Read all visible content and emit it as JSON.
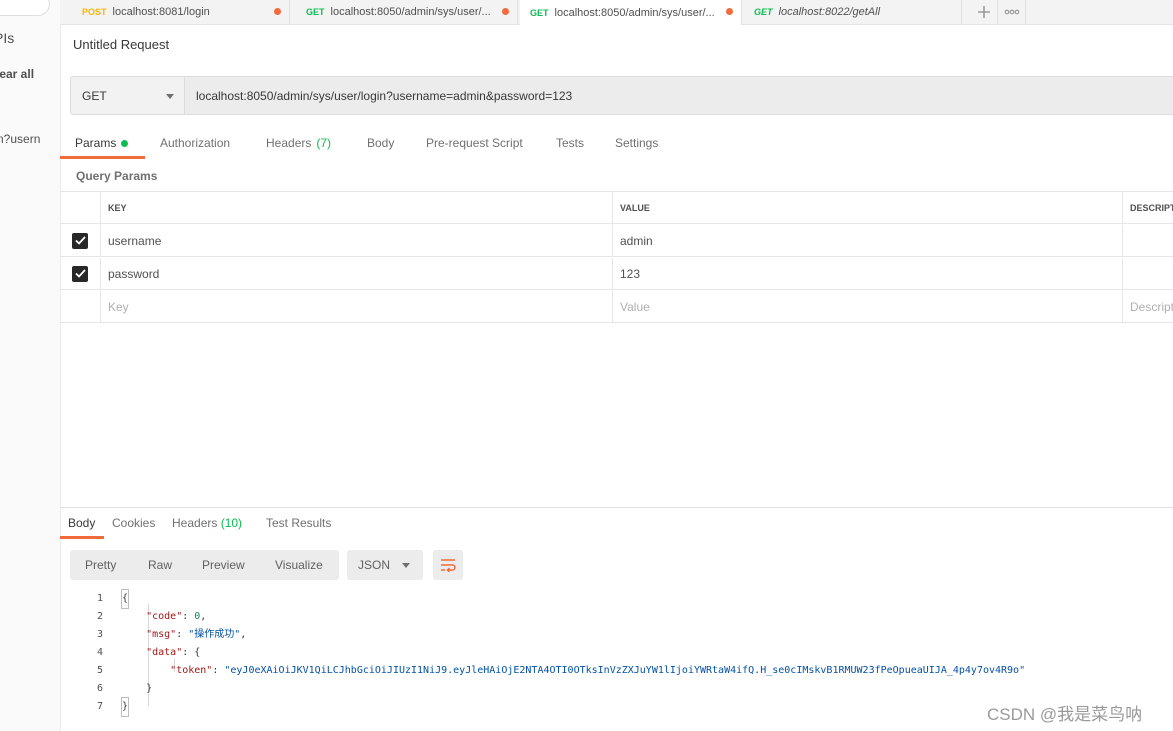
{
  "sidebar": {
    "apis_label": "PIs",
    "clear_all_label": "lear all",
    "history_item": "n?usern"
  },
  "tabs": [
    {
      "method": "POST",
      "url": "localhost:8081/login",
      "unsaved": true
    },
    {
      "method": "GET",
      "url": "localhost:8050/admin/sys/user/...",
      "unsaved": true
    },
    {
      "method": "GET",
      "url": "localhost:8050/admin/sys/user/...",
      "unsaved": true,
      "active": true
    },
    {
      "method": "GET",
      "url": "localhost:8022/getAll",
      "unsaved": false
    }
  ],
  "request": {
    "title": "Untitled Request",
    "method": "GET",
    "url": "localhost:8050/admin/sys/user/login?username=admin&password=123"
  },
  "request_tabs": {
    "params": "Params",
    "authorization": "Authorization",
    "headers": "Headers",
    "headers_count": "(7)",
    "body": "Body",
    "prerequest": "Pre-request Script",
    "tests": "Tests",
    "settings": "Settings"
  },
  "query_params": {
    "label": "Query Params",
    "headers": {
      "key": "KEY",
      "value": "VALUE",
      "description": "DESCRIPT"
    },
    "rows": [
      {
        "key": "username",
        "value": "admin",
        "checked": true
      },
      {
        "key": "password",
        "value": "123",
        "checked": true
      }
    ],
    "placeholder": {
      "key": "Key",
      "value": "Value",
      "description": "Descripti"
    }
  },
  "response_tabs": {
    "body": "Body",
    "cookies": "Cookies",
    "headers": "Headers",
    "headers_count": "(10)",
    "test_results": "Test Results"
  },
  "view": {
    "pretty": "Pretty",
    "raw": "Raw",
    "preview": "Preview",
    "visualize": "Visualize",
    "format": "JSON"
  },
  "response_body": {
    "line_numbers": [
      "1",
      "2",
      "3",
      "4",
      "5",
      "6",
      "7"
    ],
    "code_key": "\"code\"",
    "code_value": "0",
    "msg_key": "\"msg\"",
    "msg_value": "\"操作成功\"",
    "data_key": "\"data\"",
    "token_key": "\"token\"",
    "token_value": "\"eyJ0eXAiOiJKV1QiLCJhbGciOiJIUzI1NiJ9.eyJleHAiOjE2NTA4OTI0OTksInVzZXJuYW1lIjoiYWRtaW4ifQ.H_se0cIMskvB1RMUW23fPeOpueaUIJA_4p4y7ov4R9o\""
  },
  "watermark": "CSDN @我是菜鸟呐",
  "colors": {
    "accent": "#f26b3a",
    "get": "#0cbb52",
    "post": "#ffb400"
  }
}
